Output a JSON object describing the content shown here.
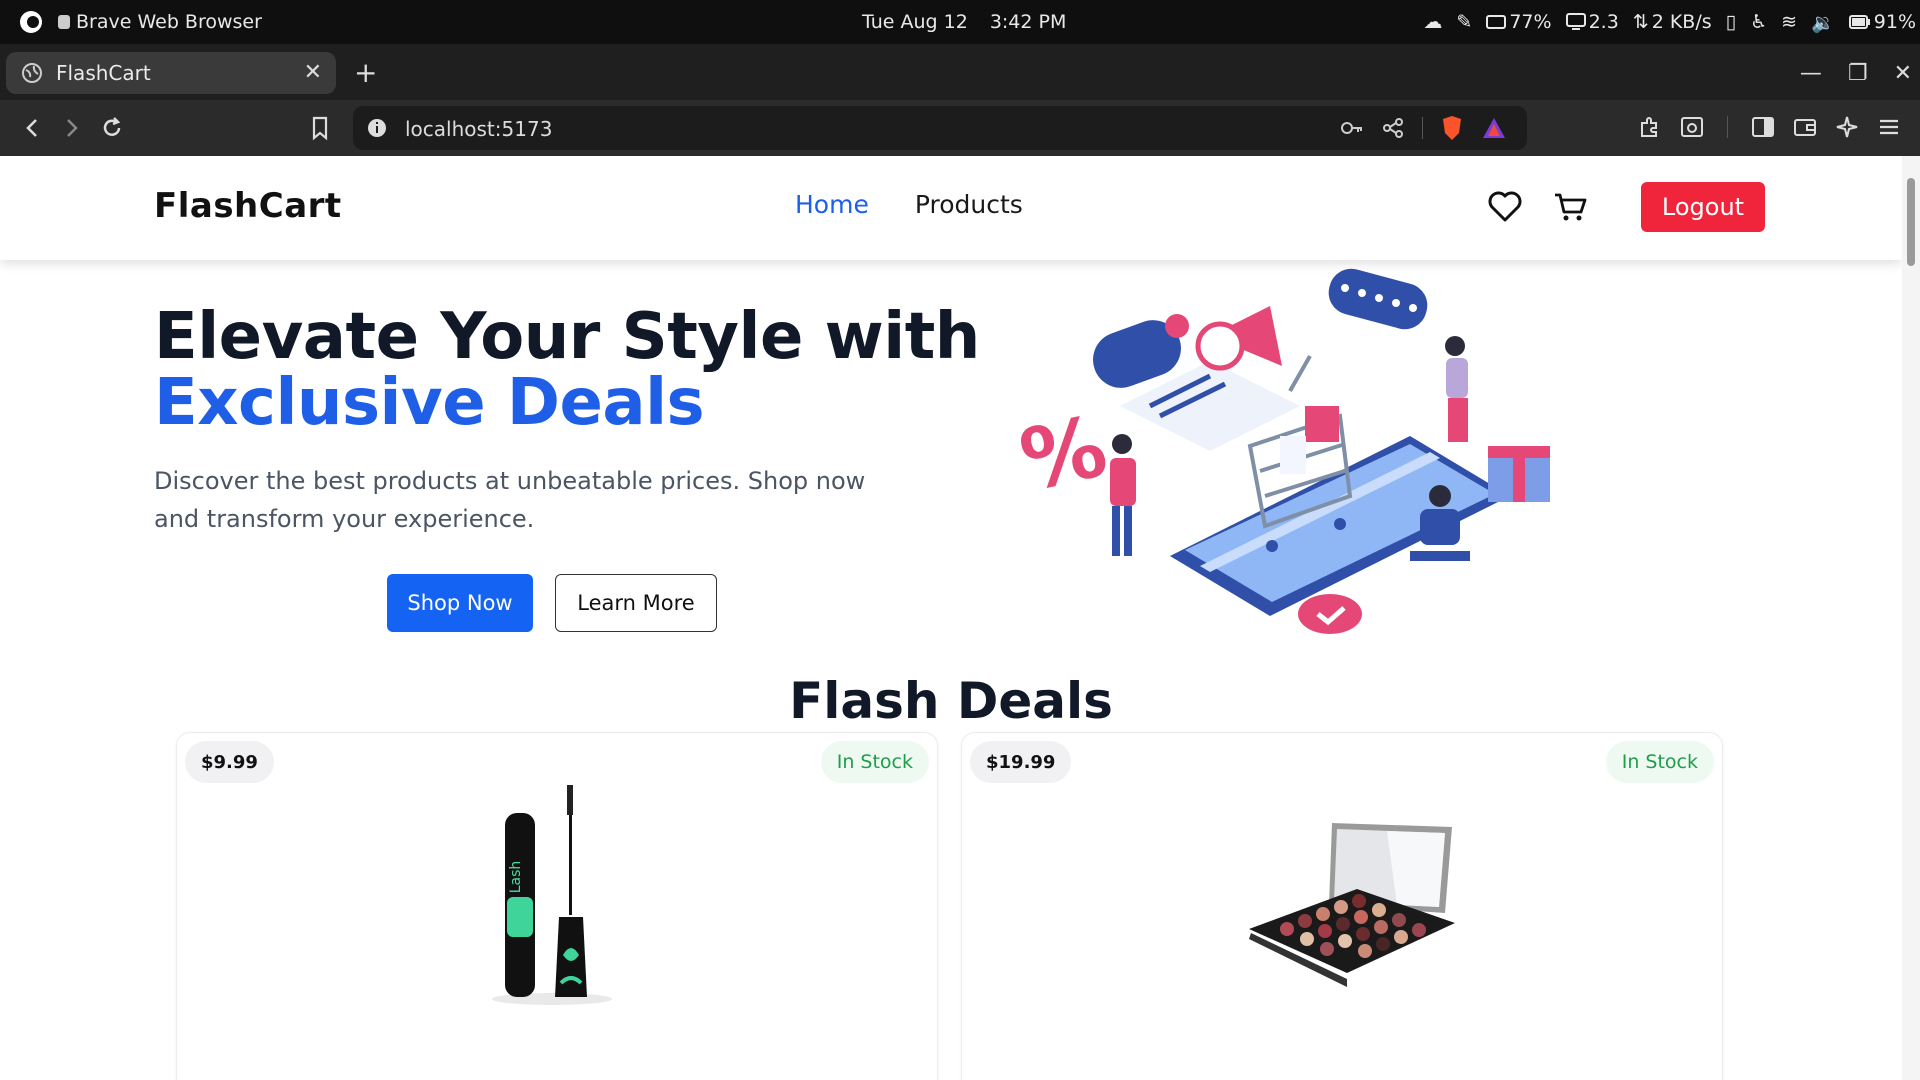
{
  "os": {
    "app_name": "Brave Web Browser",
    "date": "Tue Aug 12",
    "time": "3:42 PM",
    "cpu": "77%",
    "load": "2.3",
    "net": "2 KB/s",
    "battery": "91%"
  },
  "browser": {
    "tab_title": "FlashCart",
    "url": "localhost:5173"
  },
  "site": {
    "brand": "FlashCart",
    "nav": {
      "home": "Home",
      "products": "Products"
    },
    "logout": "Logout"
  },
  "hero": {
    "title_line1": "Elevate Your Style with",
    "title_line2": "Exclusive Deals",
    "subtitle": "Discover the best products at unbeatable prices. Shop now and transform your experience.",
    "shop_now": "Shop Now",
    "learn_more": "Learn More"
  },
  "flash_deals": {
    "title": "Flash Deals",
    "products": [
      {
        "price": "$9.99",
        "stock": "In Stock",
        "image": "mascara"
      },
      {
        "price": "$19.99",
        "stock": "In Stock",
        "image": "eyeshadow-palette"
      }
    ]
  },
  "colors": {
    "accent": "#1f5ee6",
    "logout": "#f0253c",
    "in_stock": "#1f9d4c"
  }
}
